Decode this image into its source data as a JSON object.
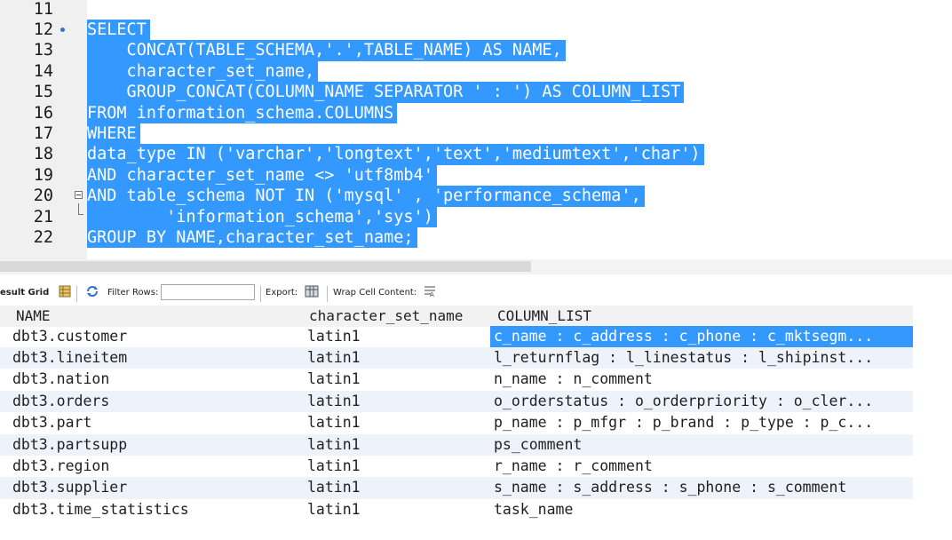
{
  "editor": {
    "lines": [
      {
        "num": "11",
        "text": "",
        "selected": false
      },
      {
        "num": "12",
        "text": "SELECT",
        "selected": true,
        "marker": "dot"
      },
      {
        "num": "13",
        "text": "    CONCAT(TABLE_SCHEMA,'.',TABLE_NAME) AS NAME,",
        "selected": true
      },
      {
        "num": "14",
        "text": "    character_set_name,",
        "selected": true
      },
      {
        "num": "15",
        "text": "    GROUP_CONCAT(COLUMN_NAME SEPARATOR ' : ') AS COLUMN_LIST",
        "selected": true
      },
      {
        "num": "16",
        "text": "FROM information_schema.COLUMNS",
        "selected": true
      },
      {
        "num": "17",
        "text": "WHERE",
        "selected": true
      },
      {
        "num": "18",
        "text": "data_type IN ('varchar','longtext','text','mediumtext','char')",
        "selected": true
      },
      {
        "num": "19",
        "text": "AND character_set_name <> 'utf8mb4'",
        "selected": true
      },
      {
        "num": "20",
        "text": "AND table_schema NOT IN ('mysql' , 'performance_schema',",
        "selected": true,
        "marker": "fold"
      },
      {
        "num": "21",
        "text": "        'information_schema','sys')",
        "selected": true,
        "marker": "fold-end"
      },
      {
        "num": "22",
        "text": "GROUP BY NAME,character_set_name;",
        "selected": true
      }
    ]
  },
  "toolbar": {
    "result_grid_label": "esult Grid",
    "filter_rows_label": "Filter Rows:",
    "filter_value": "",
    "export_label": "Export:",
    "wrap_label": "Wrap Cell Content:",
    "icons": [
      "grid-icon",
      "refresh-icon",
      "export-icon",
      "wrap-icon"
    ]
  },
  "grid": {
    "columns": [
      "NAME",
      "character_set_name",
      "COLUMN_LIST"
    ],
    "rows": [
      [
        "dbt3.customer",
        "latin1",
        "c_name : c_address : c_phone : c_mktsegm..."
      ],
      [
        "dbt3.lineitem",
        "latin1",
        "l_returnflag : l_linestatus : l_shipinst..."
      ],
      [
        "dbt3.nation",
        "latin1",
        "n_name : n_comment"
      ],
      [
        "dbt3.orders",
        "latin1",
        "o_orderstatus : o_orderpriority : o_cler..."
      ],
      [
        "dbt3.part",
        "latin1",
        "p_name : p_mfgr : p_brand : p_type : p_c..."
      ],
      [
        "dbt3.partsupp",
        "latin1",
        "ps_comment"
      ],
      [
        "dbt3.region",
        "latin1",
        "r_name : r_comment"
      ],
      [
        "dbt3.supplier",
        "latin1",
        "s_name : s_address : s_phone : s_comment"
      ],
      [
        "dbt3.time_statistics",
        "latin1",
        "task_name"
      ]
    ],
    "selected_cell": "c_name : c_address : c_phone : c_mktsegm...",
    "colors": {
      "selection": "#3399ff",
      "alt_row": "#eef3fb",
      "gutter": "#f0f0f0"
    }
  }
}
